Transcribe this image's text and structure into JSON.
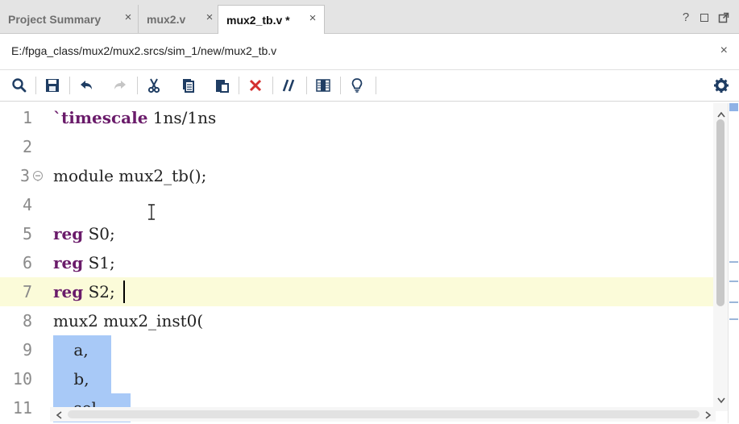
{
  "tabs": [
    {
      "label": "Project Summary",
      "close": "×"
    },
    {
      "label": "mux2.v",
      "close": "×"
    },
    {
      "label": "mux2_tb.v *",
      "close": "×"
    }
  ],
  "window_controls": {
    "help": "?"
  },
  "file_path": "E:/fpga_class/mux2/mux2.srcs/sim_1/new/mux2_tb.v",
  "close_path": "×",
  "toolbar": {
    "icons": [
      "search-icon",
      "save-icon",
      "undo-icon",
      "redo-icon",
      "cut-icon",
      "copy-icon",
      "paste-icon",
      "delete-icon",
      "comment-icon",
      "column-select-icon",
      "lightbulb-icon",
      "settings-icon"
    ]
  },
  "editor": {
    "line_numbers": [
      "1",
      "2",
      "3",
      "4",
      "5",
      "6",
      "7",
      "8",
      "9",
      "10",
      "11"
    ],
    "lines": [
      {
        "kw": "`timescale",
        "rest": " 1ns/1ns"
      },
      {
        "kw": "",
        "rest": ""
      },
      {
        "kw": "",
        "rest": "module mux2_tb();"
      },
      {
        "kw": "",
        "rest": ""
      },
      {
        "kw": "reg",
        "rest": " S0;"
      },
      {
        "kw": "reg",
        "rest": " S1;"
      },
      {
        "kw": "reg",
        "rest": " S2;"
      },
      {
        "kw": "",
        "rest": "mux2 mux2_inst0("
      },
      {
        "kw": "",
        "rest": "    a,"
      },
      {
        "kw": "",
        "rest": "    b,"
      },
      {
        "kw": "",
        "rest": "    sel"
      }
    ]
  },
  "colors": {
    "keyword": "#6a1b6a",
    "selection": "#a8c9f7",
    "current_line": "#fbfbd9",
    "delete_red": "#d32f2f"
  }
}
